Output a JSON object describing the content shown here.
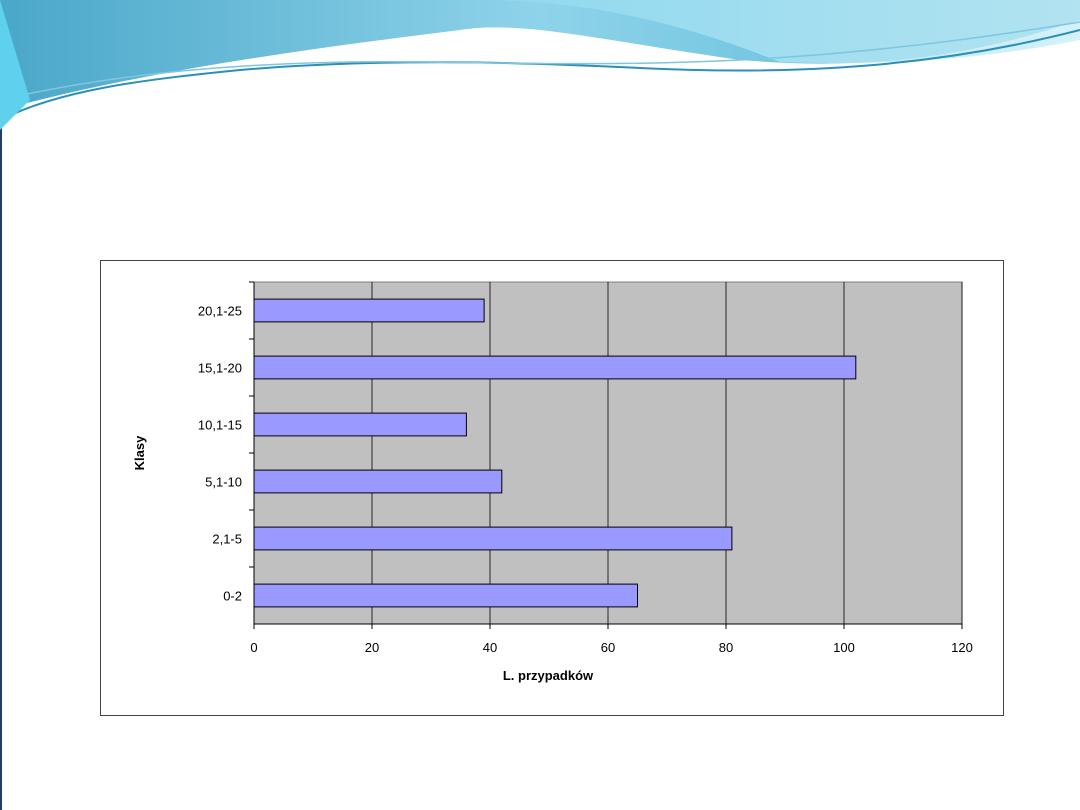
{
  "colors": {
    "plot_background": "#c0c0c0",
    "bar_fill": "#9999ff",
    "bar_stroke": "#000000",
    "gridline": "#000000",
    "wave_dark": "#3aa9cc",
    "wave_light": "#a9def0"
  },
  "chart_data": {
    "type": "bar",
    "orientation": "horizontal",
    "categories": [
      "0-2",
      "2,1-5",
      "5,1-10",
      "10,1-15",
      "15,1-20",
      "20,1-25"
    ],
    "values": [
      65,
      81,
      42,
      36,
      102,
      39
    ],
    "xlabel": "L. przypadków",
    "ylabel": "Klasy",
    "xlim": [
      0,
      120
    ],
    "x_ticks": [
      0,
      20,
      40,
      60,
      80,
      100,
      120
    ],
    "grid": true,
    "legend": "none"
  }
}
